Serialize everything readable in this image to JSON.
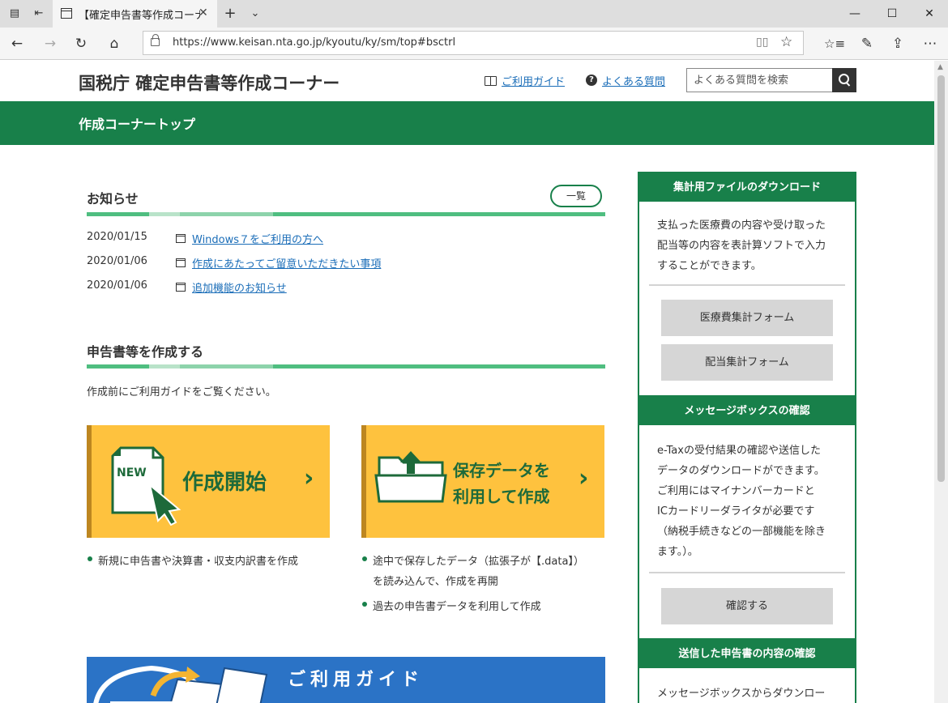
{
  "browser": {
    "tab_title": "【確定申告書等作成コーナー】",
    "url": "https://www.keisan.nta.go.jp/kyoutu/ky/sm/top#bsctrl"
  },
  "header": {
    "site_title": "国税庁 確定申告書等作成コーナー",
    "guide_link": "ご利用ガイド",
    "faq_link": "よくある質問",
    "search_placeholder": "よくある質問を検索"
  },
  "band": {
    "title": "作成コーナートップ"
  },
  "news": {
    "heading": "お知らせ",
    "list_button": "一覧",
    "items": [
      {
        "date": "2020/01/15",
        "title": "Windows７をご利用の方へ"
      },
      {
        "date": "2020/01/06",
        "title": "作成にあたってご留意いただきたい事項"
      },
      {
        "date": "2020/01/06",
        "title": "追加機能のお知らせ"
      }
    ]
  },
  "create": {
    "heading": "申告書等を作成する",
    "intro": "作成前にご利用ガイドをご覧ください。",
    "start_button": {
      "badge": "NEW",
      "label": "作成開始"
    },
    "saved_button": {
      "line1": "保存データを",
      "line2": "利用して作成"
    },
    "start_bullets": [
      "新規に申告書や決算書・収支内訳書を作成"
    ],
    "saved_bullets": [
      {
        "line1": "途中で保存したデータ（拡張子が【.data】）",
        "line2": "を読み込んで、作成を再開"
      },
      {
        "line1": "過去の申告書データを利用して作成"
      }
    ]
  },
  "guide_banner": {
    "label": "ご利用ガイド"
  },
  "sidebar": {
    "download": {
      "heading": "集計用ファイルのダウンロード",
      "text": [
        "支払った医療費の内容や受け取った",
        "配当等の内容を表計算ソフトで入力",
        "することができます。"
      ],
      "btn_medical": "医療費集計フォーム",
      "btn_dividend": "配当集計フォーム"
    },
    "message": {
      "heading": "メッセージボックスの確認",
      "text": [
        "e-Taxの受付結果の確認や送信した",
        "データのダウンロードができます。",
        "ご利用にはマイナンバーカードと",
        "ICカードリーダライタが必要です",
        "（納税手続きなどの一部機能を除き",
        "ます。）。"
      ],
      "btn_confirm": "確認する"
    },
    "sent": {
      "heading": "送信した申告書の内容の確認",
      "text": [
        "メッセージボックスからダウンロー"
      ]
    }
  }
}
